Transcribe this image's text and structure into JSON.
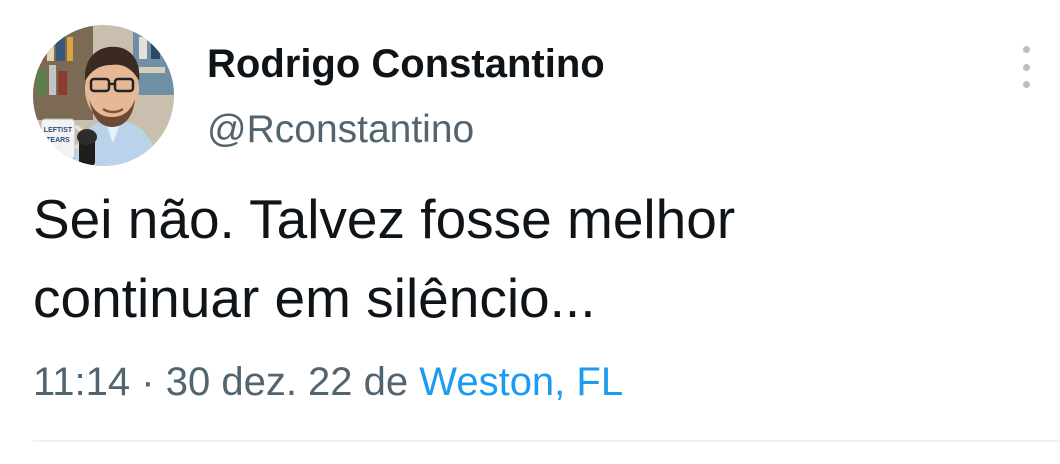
{
  "author": {
    "display_name": "Rodrigo Constantino",
    "handle": "@Rconstantino",
    "avatar_mug_text_line1": "LEFTIST",
    "avatar_mug_text_line2": "TEARS"
  },
  "tweet": {
    "text_line1": "Sei não. Talvez fosse melhor",
    "text_line2": "continuar em silêncio..."
  },
  "meta": {
    "time": "11:14",
    "separator": "·",
    "date": "30 dez. 22",
    "from_word": "de",
    "location": "Weston, FL"
  },
  "icons": {
    "more": "more-vertical-icon"
  },
  "colors": {
    "primary_text": "#0f1419",
    "secondary_text": "#536471",
    "link": "#1d9bf0",
    "divider": "#eff3f4"
  }
}
